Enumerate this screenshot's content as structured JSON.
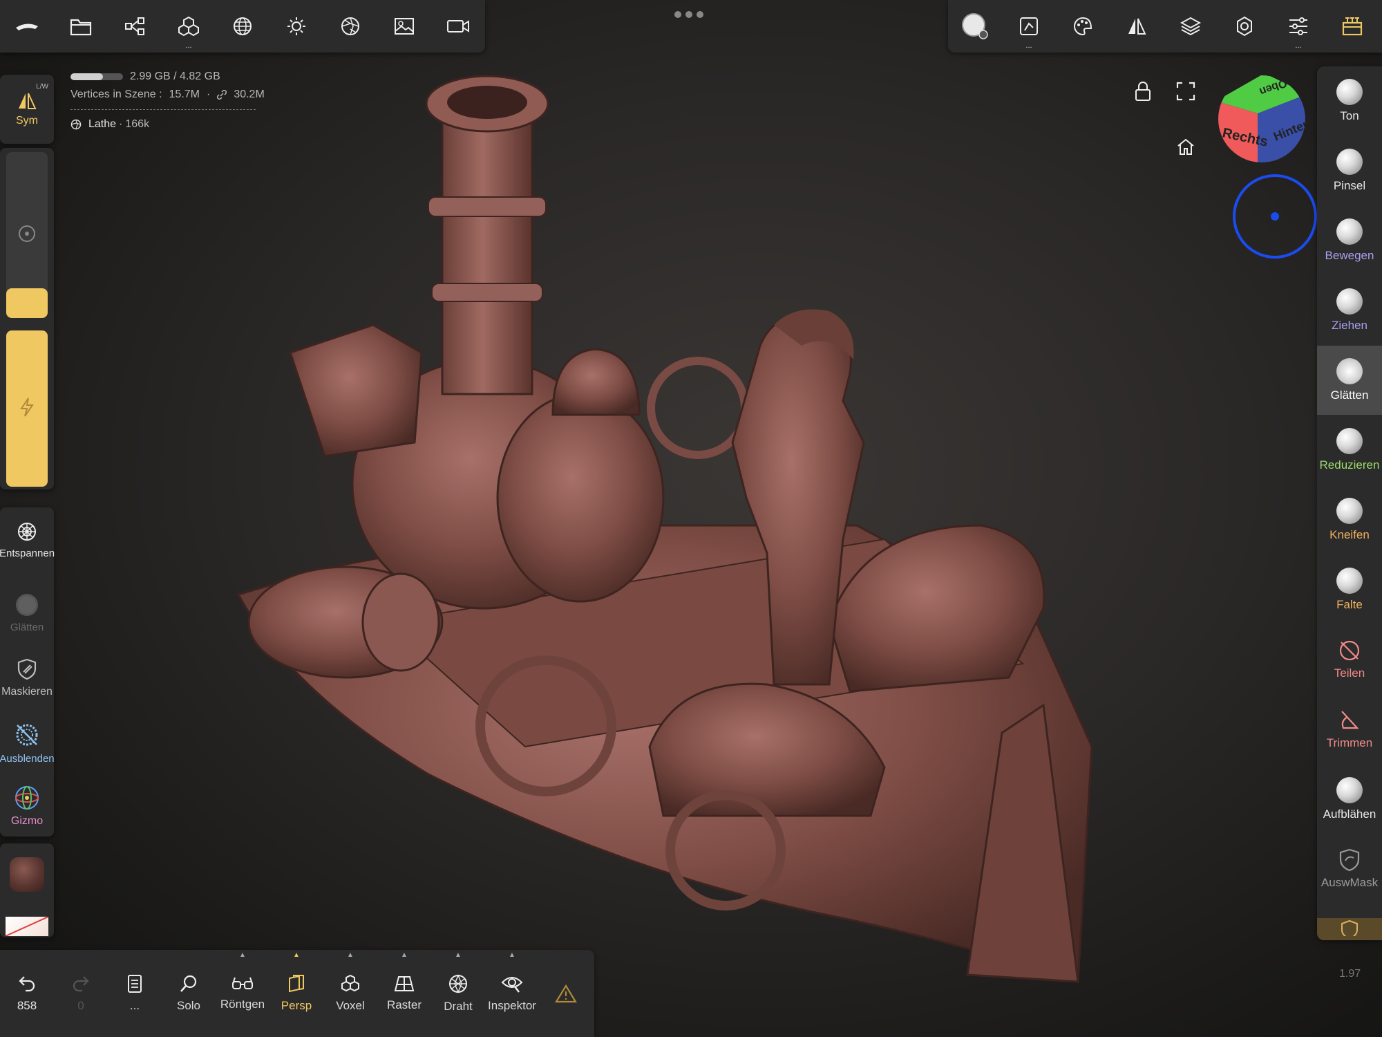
{
  "top_toolbar": {
    "left_icons": [
      "nomad-logo-icon",
      "folder-icon",
      "scene-share-icon",
      "primitives-icon",
      "sphere-grid-icon",
      "sun-icon",
      "shading-icon",
      "image-icon",
      "camera-icon"
    ],
    "right_icons": [
      "brush-settings-icon",
      "stroke-icon",
      "palette-icon",
      "symmetry-icon",
      "layers-icon",
      "settings-icon",
      "sliders-icon",
      "interface-icon"
    ]
  },
  "info": {
    "memory": "2.99 GB / 4.82 GB",
    "memory_fraction": 0.62,
    "vertices_label": "Vertices in Szene :",
    "vertices_value": "15.7M",
    "linked_value": "30.2M",
    "object_name": "Lathe",
    "object_count": "166k"
  },
  "left_bar": {
    "sym_label": "Sym",
    "sym_badge": "L/W",
    "radius_fill": 0.18,
    "intensity_fill": 1.0,
    "tools": [
      {
        "label": "Entspannen",
        "color": "#e6e6e6"
      },
      {
        "label": "Glätten",
        "color": "#6a6a6a"
      },
      {
        "label": "Maskieren",
        "color": "#bdbdbd"
      },
      {
        "label": "Ausblenden",
        "color": "#8fc3f0"
      },
      {
        "label": "Gizmo",
        "color": "#e590c8"
      }
    ]
  },
  "view": {
    "cube_labels": {
      "right": "Rechts",
      "back": "Hinten",
      "top": "Oben"
    }
  },
  "right_tools": [
    {
      "label": "Ton",
      "color": "#e6e6e6"
    },
    {
      "label": "Pinsel",
      "color": "#e6e6e6"
    },
    {
      "label": "Bewegen",
      "color": "#a8a0f0"
    },
    {
      "label": "Ziehen",
      "color": "#a8a0f0"
    },
    {
      "label": "Glätten",
      "color": "#ffffff"
    },
    {
      "label": "Reduzieren",
      "color": "#9bdc6a"
    },
    {
      "label": "Kneifen",
      "color": "#f0b060"
    },
    {
      "label": "Falte",
      "color": "#f0b060"
    },
    {
      "label": "Teilen",
      "color": "#f28a8a"
    },
    {
      "label": "Trimmen",
      "color": "#f28a8a"
    },
    {
      "label": "Aufblähen",
      "color": "#e6e6e6"
    },
    {
      "label": "AuswMask",
      "color": "#9a9a9a"
    }
  ],
  "bottom_toolbar": {
    "undo_count": "858",
    "redo_count": "0",
    "more_label": "...",
    "items": [
      "Solo",
      "Röntgen",
      "Persp",
      "Voxel",
      "Raster",
      "Draht",
      "Inspektor"
    ]
  },
  "version": "1.97",
  "colors": {
    "accent": "#f0c862",
    "panel": "#2b2b2b",
    "model": "#8a5a50"
  }
}
